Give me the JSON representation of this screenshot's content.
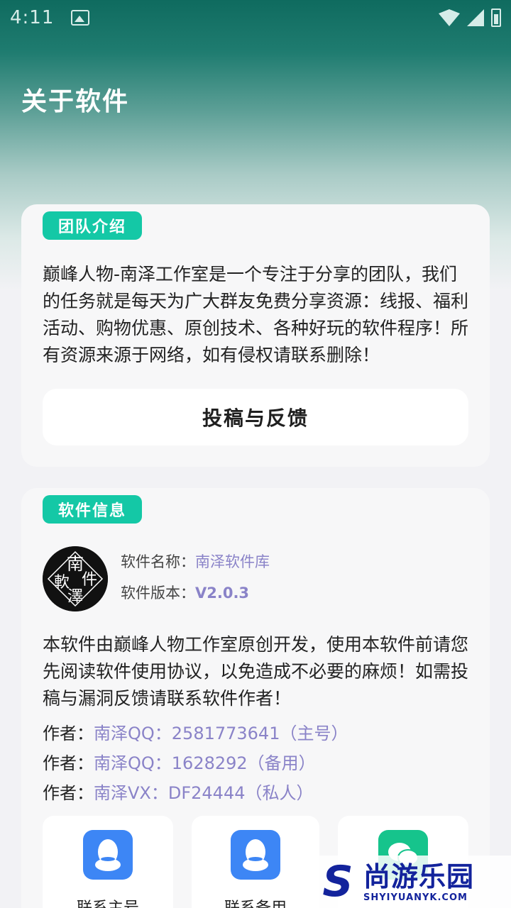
{
  "status_bar": {
    "time": "4:11"
  },
  "header": {
    "title": "关于软件"
  },
  "team_card": {
    "tag": "团队介绍",
    "description": "巅峰人物-南泽工作室是一个专注于分享的团队，我们的任务就是每天为广大群友免费分享资源：线报、福利活动、购物优惠、原创技术、各种好玩的软件程序！所有资源来源于网络，如有侵权请联系删除！",
    "feedback_button": "投稿与反馈"
  },
  "info_card": {
    "tag": "软件信息",
    "name_label": "软件名称：",
    "name_value": "南泽软件库",
    "version_label": "软件版本：",
    "version_value": "V2.0.3",
    "description": "本软件由巅峰人物工作室原创开发，使用本软件前请您先阅读软件使用协议，以免造成不必要的麻烦！如需投稿与漏洞反馈请联系软件作者！",
    "authors": [
      {
        "label": "作者：",
        "value": "南泽QQ：2581773641（主号）"
      },
      {
        "label": "作者：",
        "value": "南泽QQ：1628292（备用）"
      },
      {
        "label": "作者：",
        "value": "南泽VX：DF24444（私人）"
      }
    ],
    "contacts": [
      {
        "label": "联系主号",
        "icon": "qq-icon"
      },
      {
        "label": "联系备用",
        "icon": "qq-icon"
      },
      {
        "label": "",
        "icon": "wechat-icon"
      }
    ]
  },
  "logo": {
    "chars": [
      "南",
      "件",
      "軟",
      "澤"
    ]
  },
  "watermark": {
    "letter": "S",
    "title": "尚游乐园",
    "subtitle": "SHYIYUANYK.COM"
  },
  "colors": {
    "accent": "#14c8a6",
    "link": "#8a83c8",
    "qq_blue": "#3d86f5",
    "wechat_green": "#16c48c",
    "header_dark": "#0f6b5f"
  }
}
